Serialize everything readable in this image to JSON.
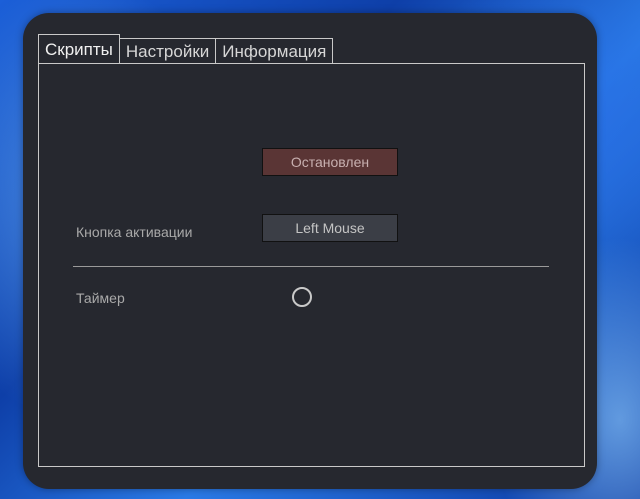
{
  "tabs": [
    {
      "label": "Скрипты",
      "active": true
    },
    {
      "label": "Настройки",
      "active": false
    },
    {
      "label": "Информация",
      "active": false
    }
  ],
  "scripts_tab": {
    "status_button": "Остановлен",
    "activation": {
      "label": "Кнопка активации",
      "key_button": "Left Mouse"
    },
    "timer": {
      "label": "Таймер",
      "checked": false
    }
  },
  "colors": {
    "window_bg": "#26282f",
    "status_button_bg": "#5a3535",
    "key_button_bg": "#3b3e46",
    "border": "#c9c9c9"
  }
}
